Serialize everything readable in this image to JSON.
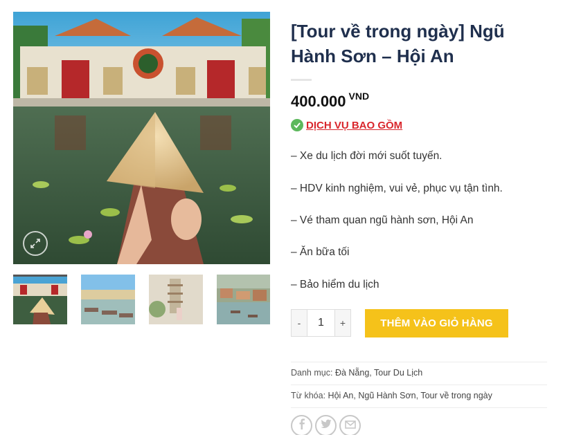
{
  "product": {
    "title": "[Tour về trong ngày] Ngũ Hành Sơn – Hội An",
    "price": "400.000",
    "currency": "VND",
    "includes_label": "DỊCH VỤ BAO GỒM",
    "features": [
      "– Xe du lịch đời mới suốt tuyến.",
      "– HDV kinh nghiệm, vui vẻ, phục vụ tận tình.",
      "– Vé tham quan ngũ hành sơn, Hội An",
      "– Ăn bữa tối",
      "– Bảo hiểm du lịch"
    ]
  },
  "cart": {
    "minus": "-",
    "quantity": "1",
    "plus": "+",
    "add_label": "THÊM VÀO GIỎ HÀNG"
  },
  "meta": {
    "category_label": "Danh mục:",
    "categories": [
      "Đà Nẵng",
      "Tour Du Lịch"
    ],
    "tag_label": "Từ khóa:",
    "tags": [
      "Hội An",
      "Ngũ Hành Sơn",
      "Tour về trong ngày"
    ],
    "sep": ", "
  },
  "icons": {
    "zoom": "zoom-icon",
    "check": "check-circle-icon",
    "share": [
      "facebook-icon",
      "twitter-icon",
      "email-icon"
    ]
  },
  "colors": {
    "title": "#1f2f4d",
    "accent_red": "#d9262c",
    "button_yellow": "#f5c21a",
    "check_green": "#5cb85c"
  }
}
